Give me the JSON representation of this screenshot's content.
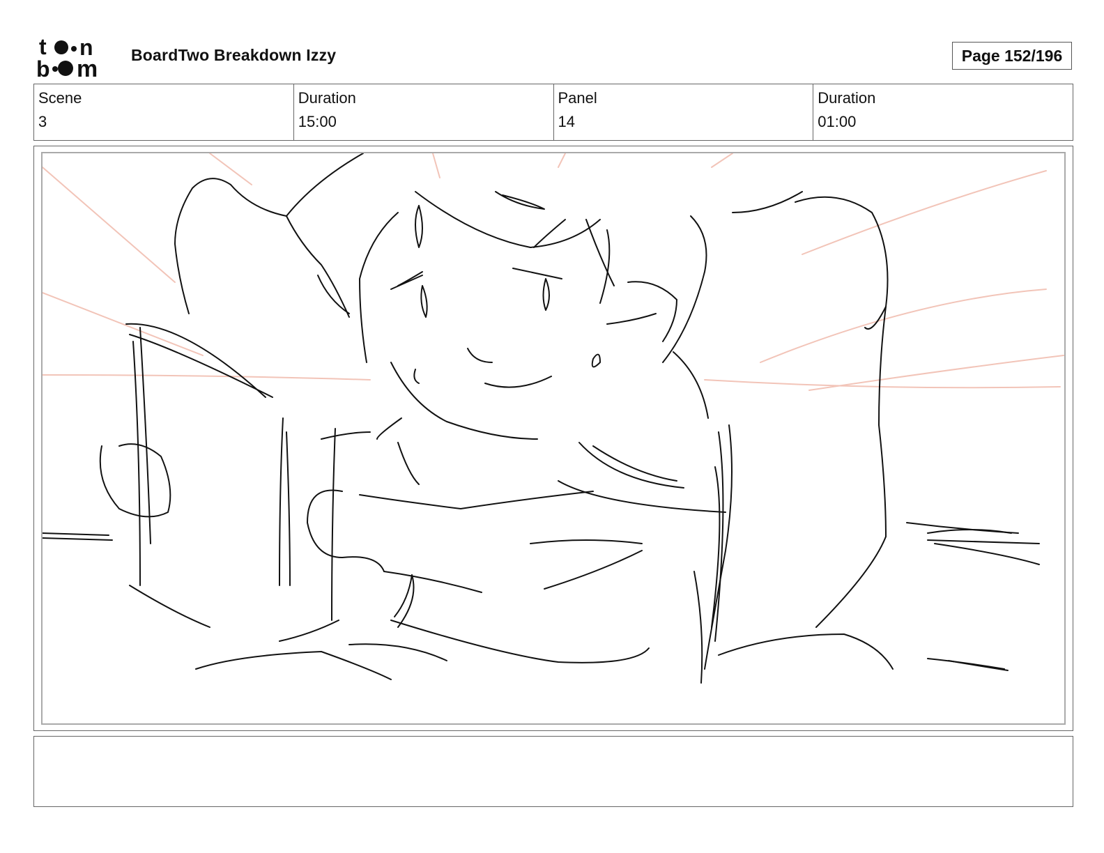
{
  "header": {
    "logo_text": "toonboom",
    "title": "BoardTwo Breakdown Izzy",
    "page": "Page 152/196"
  },
  "info": [
    {
      "label": "Scene",
      "value": "3"
    },
    {
      "label": "Duration",
      "value": "15:00"
    },
    {
      "label": "Panel",
      "value": "14"
    },
    {
      "label": "Duration",
      "value": "01:00"
    }
  ],
  "panel": {
    "image": "storyboard-sketch",
    "stroke_color": "#111111",
    "guide_color": "#f2c4b8"
  },
  "notes": {
    "text": ""
  }
}
